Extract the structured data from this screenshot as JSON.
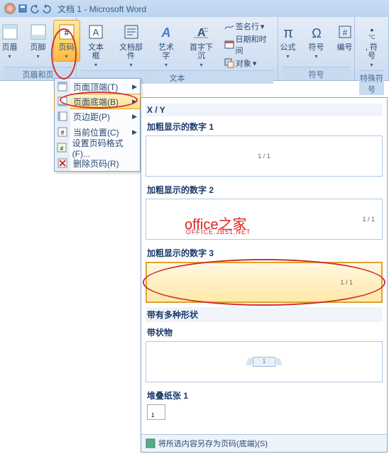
{
  "titlebar": {
    "doc": "文档 1",
    "app": "Microsoft Word"
  },
  "ribbon": {
    "group1": {
      "label": "页眉和页",
      "btns": {
        "header": "页眉",
        "footer": "页脚",
        "pagenum": "页码"
      }
    },
    "group2": {
      "label": "文本",
      "btns": {
        "textbox": "文本框",
        "quickparts": "文档部件",
        "wordart": "艺术字",
        "dropcap": "首字下沉"
      },
      "side": {
        "sig": "签名行",
        "datetime": "日期和时间",
        "object": "对象"
      }
    },
    "group3": {
      "label": "符号",
      "btns": {
        "equation": "公式",
        "symbol": "符号",
        "number": "编号"
      }
    },
    "group4": {
      "label": "特殊符号",
      "btns": {
        "special": ", 符号"
      }
    }
  },
  "menu": {
    "items": [
      {
        "label": "页面顶端(T)",
        "icon": "page-top"
      },
      {
        "label": "页面底端(B)",
        "icon": "page-bottom"
      },
      {
        "label": "页边距(P)",
        "icon": "page-margin"
      },
      {
        "label": "当前位置(C)",
        "icon": "current-pos"
      },
      {
        "label": "设置页码格式(F)...",
        "icon": "format"
      },
      {
        "label": "删除页码(R)",
        "icon": "remove"
      }
    ]
  },
  "gallery": {
    "sec_xy": "X / Y",
    "items": [
      {
        "name": "加粗显示的数字 1",
        "sample": "1 / 1"
      },
      {
        "name": "加粗显示的数字 2",
        "sample": "1 / 1"
      },
      {
        "name": "加粗显示的数字 3",
        "sample": "1 / 1"
      }
    ],
    "sec_shapes": "带有多种形状",
    "shape_item": {
      "name": "带状物",
      "sample": "1"
    },
    "sec_stack": "堆叠纸张 1",
    "stack_sample": "1",
    "footer": "将所选内容另存为页码(底端)(S)"
  },
  "watermark": {
    "l1": "office之家",
    "l2": "OFFICE.JB51.NET"
  }
}
